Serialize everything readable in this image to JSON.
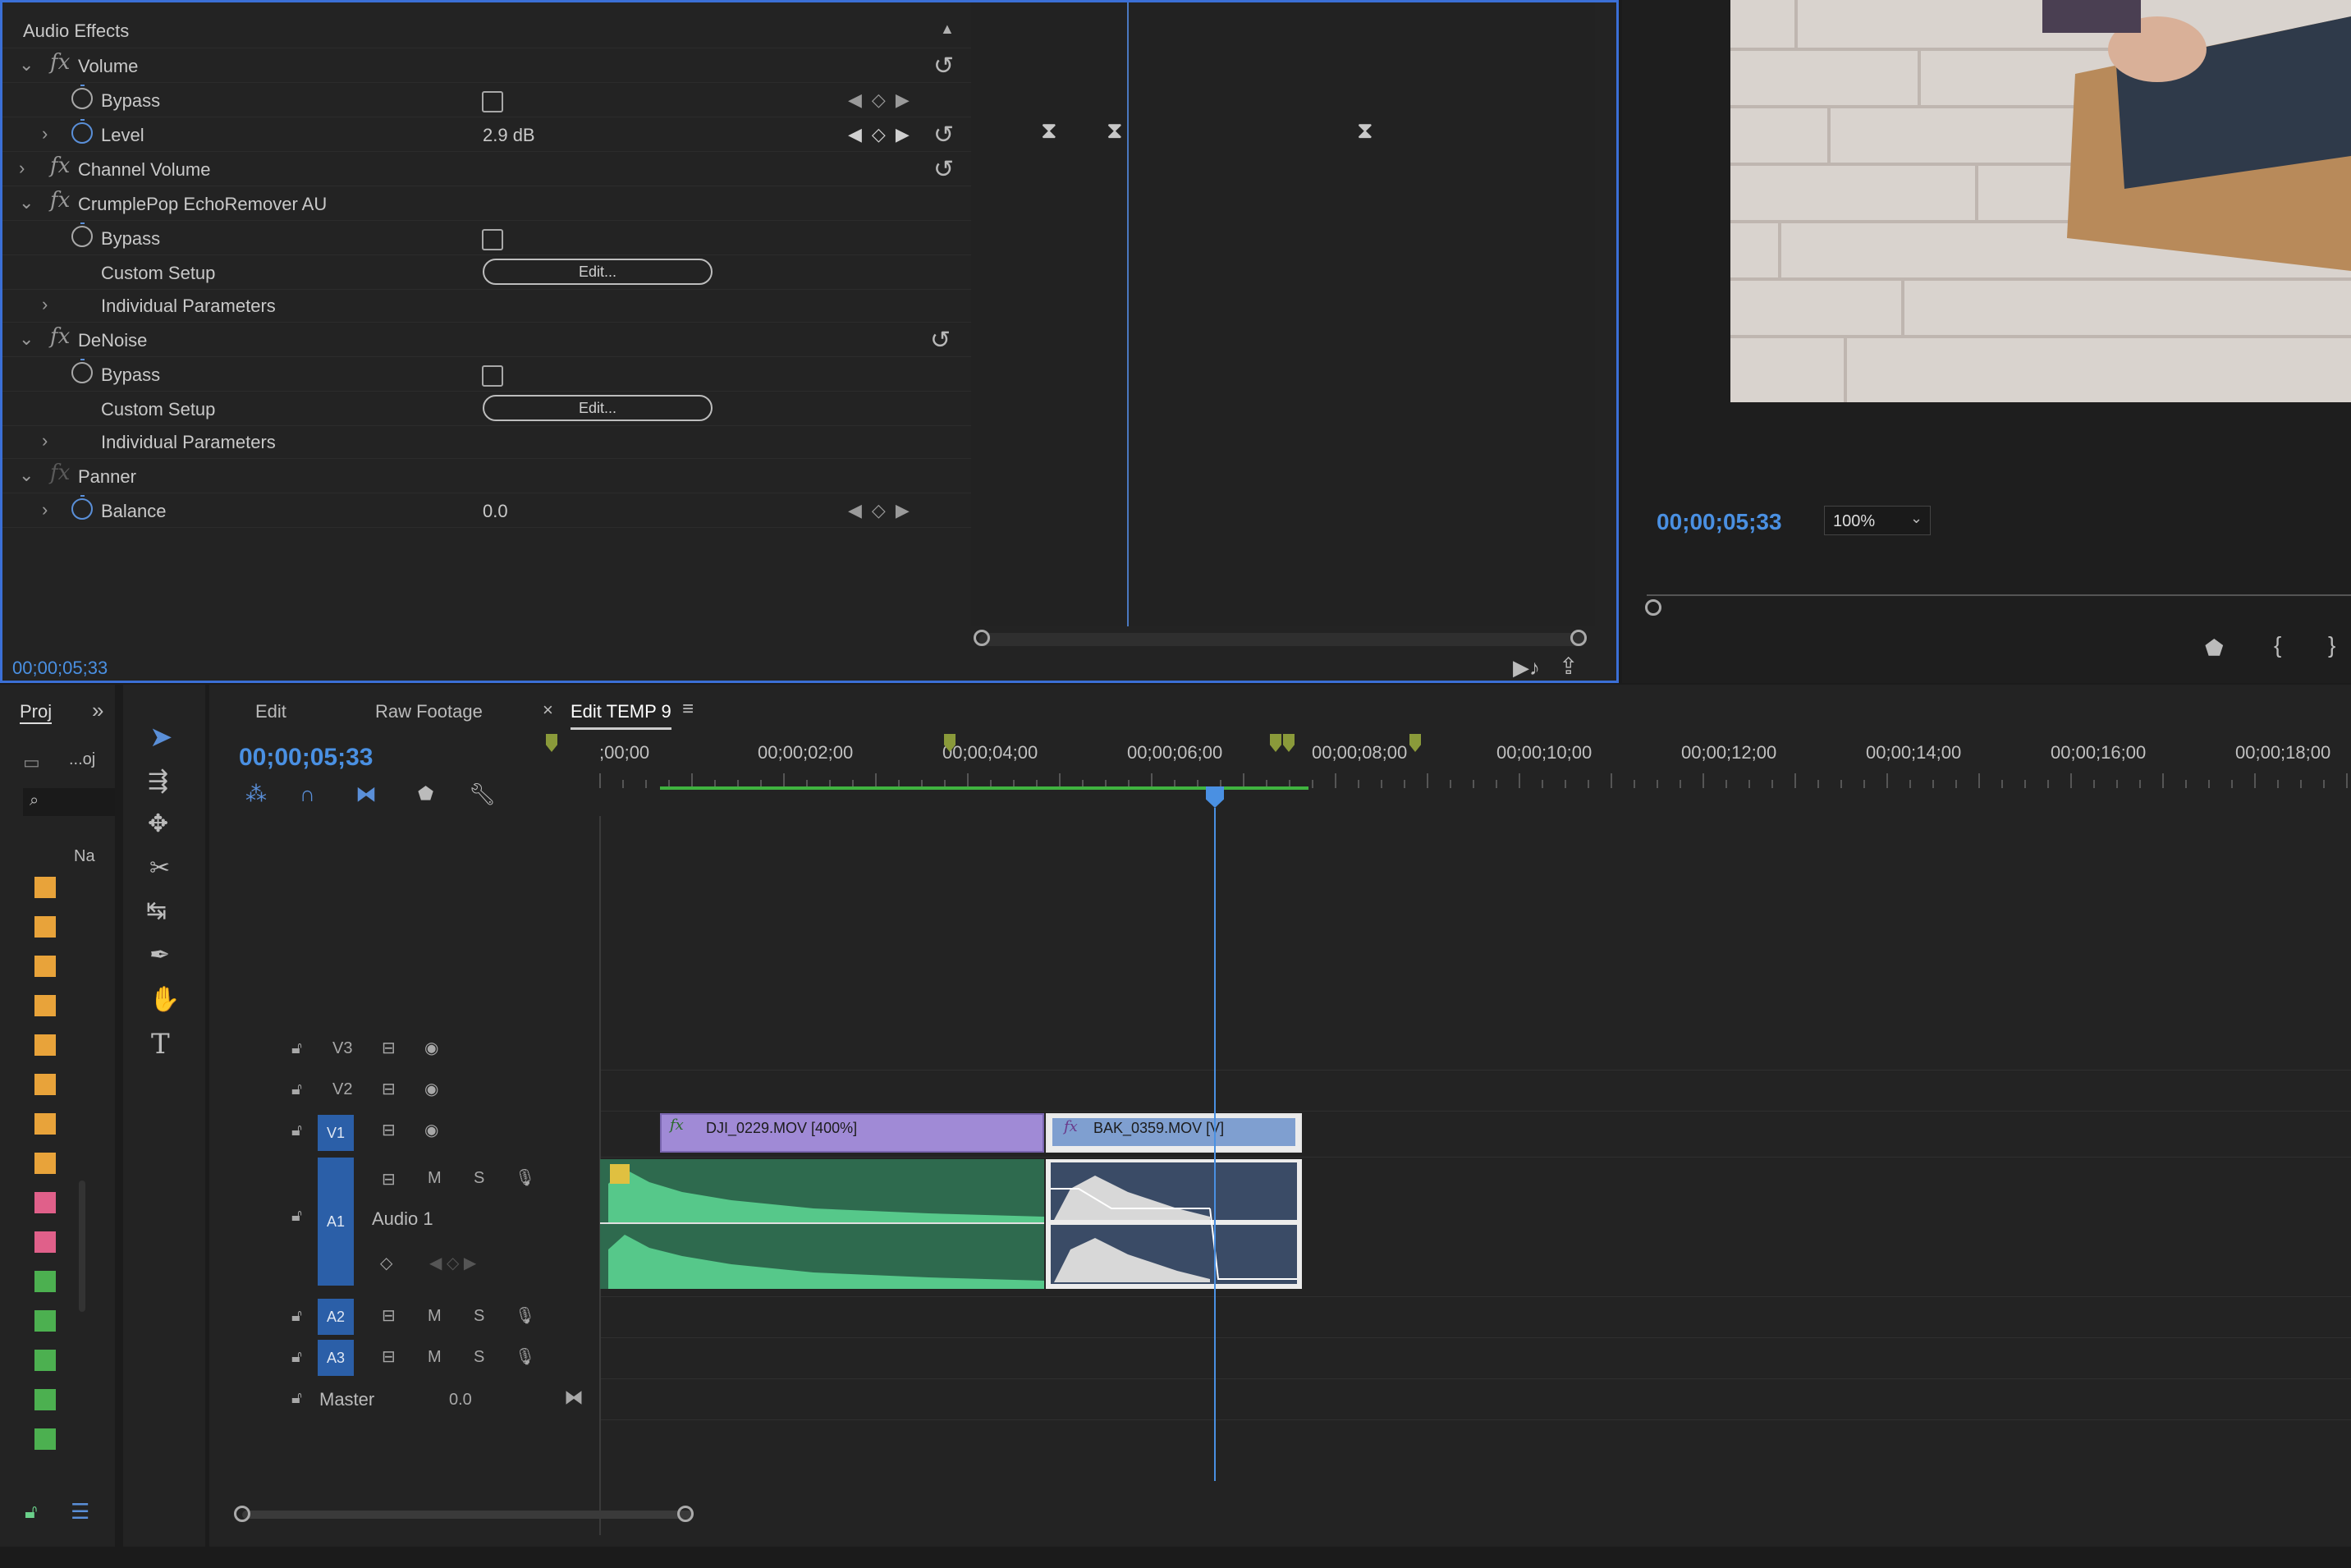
{
  "effect_controls": {
    "section_title": "Audio Effects",
    "rows": [
      {
        "kind": "effect",
        "label": "Volume",
        "expanded": true
      },
      {
        "kind": "param",
        "label": "Bypass",
        "control": "checkbox"
      },
      {
        "kind": "param",
        "label": "Level",
        "value": "2.9 dB",
        "expandable": true
      },
      {
        "kind": "effect",
        "label": "Channel Volume",
        "expanded": false
      },
      {
        "kind": "effect",
        "label": "CrumplePop EchoRemover AU",
        "expanded": true
      },
      {
        "kind": "param",
        "label": "Bypass",
        "control": "checkbox"
      },
      {
        "kind": "param",
        "label": "Custom Setup",
        "button": "Edit..."
      },
      {
        "kind": "param",
        "label": "Individual Parameters",
        "expandable": true
      },
      {
        "kind": "effect",
        "label": "DeNoise",
        "expanded": true
      },
      {
        "kind": "param",
        "label": "Bypass",
        "control": "checkbox"
      },
      {
        "kind": "param",
        "label": "Custom Setup",
        "button": "Edit..."
      },
      {
        "kind": "param",
        "label": "Individual Parameters",
        "expandable": true
      },
      {
        "kind": "effect",
        "label": "Panner",
        "expanded": true
      },
      {
        "kind": "param",
        "label": "Balance",
        "value": "0.0",
        "expandable": true
      }
    ],
    "timecode": "00;00;05;33"
  },
  "program_monitor": {
    "timecode": "00;00;05;33",
    "zoom": "100%"
  },
  "project_panel": {
    "tab": "Proj",
    "item_label": "...oj",
    "column_header": "Na"
  },
  "timeline": {
    "tabs": [
      {
        "label": "Edit",
        "active": false
      },
      {
        "label": "Raw Footage",
        "active": false
      },
      {
        "label": "Edit TEMP 9",
        "active": true
      }
    ],
    "timecode": "00;00;05;33",
    "ruler_labels": [
      ";00;00",
      "00;00;02;00",
      "00;00;04;00",
      "00;00;06;00",
      "00;00;08;00",
      "00;00;10;00",
      "00;00;12;00",
      "00;00;14;00",
      "00;00;16;00",
      "00;00;18;00"
    ],
    "tracks": {
      "v3": "V3",
      "v2": "V2",
      "v1": "V1",
      "a1": "A1",
      "a1_name": "Audio 1",
      "a2": "A2",
      "a3": "A3",
      "mute": "M",
      "solo": "S",
      "master": "Master",
      "master_value": "0.0"
    },
    "clips": {
      "v1_a": "DJI_0229.MOV [400%]",
      "v1_b": "BAK_0359.MOV [V]"
    }
  },
  "colors": {
    "accent": "#4a90e2",
    "video_clip_a": "#a08ad6",
    "video_clip_b": "#7f9fd0",
    "audio_clip_a": "#2e6a4e",
    "audio_clip_b": "#3a4b66",
    "marker": "#8a9a3a",
    "label_orange": "#e8a33a",
    "label_pink": "#e0608a",
    "label_green": "#4cb050"
  }
}
